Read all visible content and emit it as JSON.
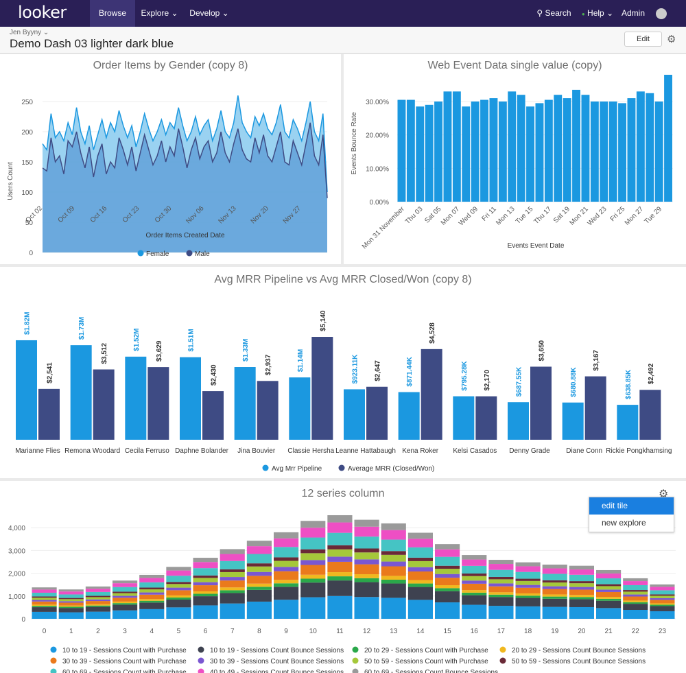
{
  "nav": {
    "logo": "looker",
    "browse": "Browse",
    "explore": "Explore",
    "develop": "Develop",
    "search": "Search",
    "help": "Help",
    "admin": "Admin"
  },
  "header": {
    "owner": "Jen Byyny",
    "title": "Demo Dash 03 lighter dark blue",
    "edit": "Edit"
  },
  "colors": {
    "bar_blue": "#1b98e0",
    "navy": "#3e4b84",
    "nav_bg": "#2a1f56"
  },
  "tile_menu": {
    "items": [
      "edit tile",
      "new explore"
    ]
  },
  "chart_data": [
    {
      "type": "area",
      "title": "Order Items by Gender (copy 8)",
      "xlabel": "Order Items Created Date",
      "ylabel": "Users Count",
      "ylim": [
        0,
        275
      ],
      "yticks": [
        0,
        50,
        100,
        150,
        200,
        250
      ],
      "xticks": [
        "Oct 02",
        "Oct 09",
        "Oct 16",
        "Oct 23",
        "Oct 30",
        "Nov 06",
        "Nov 13",
        "Nov 20",
        "Nov 27"
      ],
      "series": [
        {
          "name": "Female",
          "color": "#1b98e0",
          "values": [
            180,
            170,
            230,
            190,
            200,
            185,
            215,
            195,
            240,
            200,
            180,
            210,
            170,
            195,
            220,
            190,
            215,
            200,
            235,
            210,
            190,
            210,
            175,
            200,
            230,
            205,
            185,
            200,
            220,
            195,
            215,
            205,
            240,
            210,
            185,
            200,
            225,
            195,
            210,
            220,
            185,
            205,
            235,
            200,
            190,
            215,
            260,
            215,
            200,
            190,
            225,
            210,
            230,
            205,
            195,
            215,
            245,
            200,
            190,
            220,
            205,
            185,
            215,
            250,
            200,
            185,
            230,
            100
          ]
        },
        {
          "name": "Male",
          "color": "#3e4b84",
          "values": [
            140,
            135,
            190,
            150,
            160,
            130,
            185,
            175,
            200,
            165,
            140,
            175,
            125,
            160,
            180,
            130,
            150,
            140,
            190,
            170,
            145,
            175,
            135,
            165,
            195,
            170,
            145,
            160,
            185,
            150,
            175,
            160,
            205,
            175,
            140,
            170,
            190,
            155,
            175,
            185,
            150,
            165,
            200,
            165,
            150,
            180,
            205,
            170,
            155,
            150,
            190,
            165,
            195,
            160,
            150,
            175,
            200,
            150,
            145,
            185,
            165,
            145,
            180,
            215,
            160,
            145,
            195,
            90
          ]
        }
      ],
      "legend": "bottom"
    },
    {
      "type": "bar",
      "title": "Web Event Data single value (copy)",
      "xlabel": "Events Event Date",
      "ylabel": "Events Bounce Rate",
      "ylim": [
        0,
        0.38
      ],
      "yticks": [
        "0.00%",
        "10.00%",
        "20.00%",
        "30.00%"
      ],
      "xticks": [
        "Mon 31 November",
        "Thu 03",
        "Sat 05",
        "Mon 07",
        "Wed 09",
        "Fri 11",
        "Mon 13",
        "Tue 15",
        "Thu 17",
        "Sat 19",
        "Mon 21",
        "Wed 23",
        "Fri 25",
        "Mon 27",
        "Tue 29"
      ],
      "values": [
        0.305,
        0.305,
        0.285,
        0.29,
        0.3,
        0.33,
        0.33,
        0.285,
        0.3,
        0.305,
        0.31,
        0.3,
        0.33,
        0.32,
        0.285,
        0.295,
        0.305,
        0.32,
        0.31,
        0.335,
        0.32,
        0.3,
        0.3,
        0.3,
        0.295,
        0.31,
        0.33,
        0.325,
        0.3,
        0.38
      ]
    },
    {
      "type": "bar",
      "title": "Avg MRR Pipeline vs Avg MRR Closed/Won (copy 8)",
      "categories": [
        "Marianne Flies",
        "Remona Woodard",
        "Cecila Ferruso",
        "Daphne Bolander",
        "Jina Bouvier",
        "Classie Hersha",
        "Leanne Hattabaugh",
        "Kena Roker",
        "Kelsi Casados",
        "Denny Grade",
        "Diane Conn",
        "Rickie Pongkhamsing"
      ],
      "series": [
        {
          "name": "Avg Mrr Pipeline",
          "color": "#1b98e0",
          "labels": [
            "$1.82M",
            "$1.73M",
            "$1.52M",
            "$1.51M",
            "$1.33M",
            "$1.14M",
            "$923.11K",
            "$871.44K",
            "$795.28K",
            "$687.55K",
            "$680.88K",
            "$638.85K"
          ],
          "values": [
            1820000,
            1730000,
            1520000,
            1510000,
            1330000,
            1140000,
            923110,
            871440,
            795280,
            687550,
            680880,
            638850
          ]
        },
        {
          "name": "Average MRR (Closed/Won)",
          "color": "#3e4b84",
          "labels": [
            "$2,541",
            "$3,512",
            "$3,629",
            "$2,430",
            "$2,937",
            "$5,140",
            "$2,647",
            "$4,528",
            "$2,170",
            "$3,650",
            "$3,167",
            "$2,492"
          ],
          "values": [
            2541,
            3512,
            3629,
            2430,
            2937,
            5140,
            2647,
            4528,
            2170,
            3650,
            3167,
            2492
          ]
        }
      ],
      "legend": "bottom"
    },
    {
      "type": "bar",
      "stacked": true,
      "title": "12 series column",
      "ylim": [
        0,
        4700
      ],
      "yticks": [
        "0",
        "1,000",
        "2,000",
        "3,000",
        "4,000"
      ],
      "categories": [
        "0",
        "1",
        "2",
        "3",
        "4",
        "5",
        "6",
        "7",
        "8",
        "9",
        "10",
        "11",
        "12",
        "13",
        "14",
        "15",
        "16",
        "17",
        "18",
        "19",
        "20",
        "21",
        "22",
        "23"
      ],
      "totals": [
        1380,
        1290,
        1420,
        1680,
        1930,
        2280,
        2680,
        3060,
        3430,
        3800,
        4300,
        4550,
        4350,
        4190,
        3780,
        3280,
        2800,
        2590,
        2480,
        2380,
        2330,
        2140,
        1780,
        1510
      ],
      "series": [
        {
          "name": "10 to 19 - Sessions Count with Purchase",
          "color": "#1b98e0"
        },
        {
          "name": "10 to 19 - Sessions Count Bounce Sessions",
          "color": "#3e4250"
        },
        {
          "name": "20 to 29 - Sessions Count with Purchase",
          "color": "#2aa84a"
        },
        {
          "name": "20 to 29 - Sessions Count Bounce Sessions",
          "color": "#f0b81f"
        },
        {
          "name": "30 to 39 - Sessions Count with Purchase",
          "color": "#ea7a1c"
        },
        {
          "name": "30 to 39 - Sessions Count Bounce Sessions",
          "color": "#7a57d1"
        },
        {
          "name": "50 to 59 - Sessions Count with Purchase",
          "color": "#a5c83a"
        },
        {
          "name": "50 to 59 - Sessions Count Bounce Sessions",
          "color": "#6a2a37"
        },
        {
          "name": "60 to 69 - Sessions Count with Purchase",
          "color": "#45c4c4"
        },
        {
          "name": "40 to 49 - Sessions Count Bounce Sessions",
          "color": "#ee4fc4"
        },
        {
          "name": "60 to 69 - Sessions Count Bounce Sessions",
          "color": "#9a9a9a"
        }
      ],
      "weights": [
        0.22,
        0.15,
        0.04,
        0.04,
        0.1,
        0.05,
        0.07,
        0.04,
        0.12,
        0.1,
        0.07
      ],
      "legend": "bottom"
    }
  ]
}
